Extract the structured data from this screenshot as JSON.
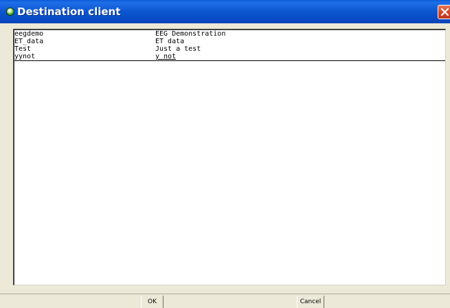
{
  "window": {
    "title": "Destination client"
  },
  "list": {
    "rows": [
      {
        "name": "eegdemo",
        "description": "EEG Demonstration"
      },
      {
        "name": "ET_data",
        "description": "ET data"
      },
      {
        "name": "Test",
        "description": "Just a test"
      },
      {
        "name": "yynot",
        "description": "y not"
      }
    ],
    "selected_index": 3
  },
  "buttons": {
    "ok_label": "OK",
    "cancel_label": "Cancel"
  },
  "icons": {
    "title": "app-orb-icon",
    "close": "close-icon"
  },
  "colors": {
    "titlebar": "#0b57d0",
    "close_button": "#d4472a",
    "dialog_background": "#ece9d8"
  }
}
